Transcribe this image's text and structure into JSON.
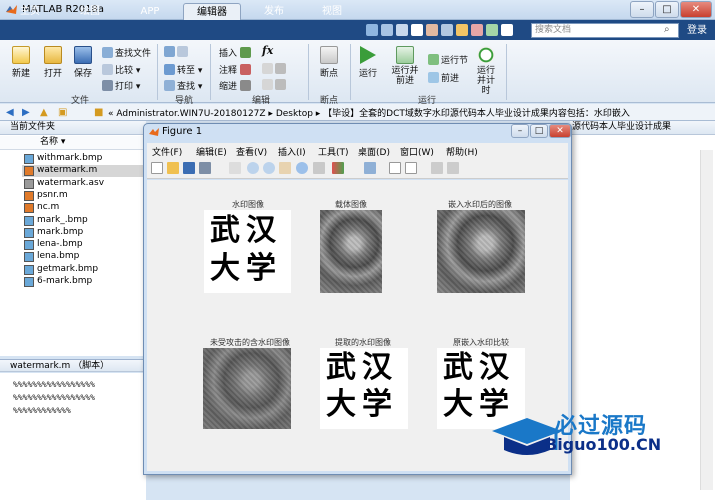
{
  "app": {
    "title": "MATLAB R2018a",
    "window_controls": [
      "–",
      "□",
      "✕"
    ]
  },
  "tabs": [
    {
      "label": "主页"
    },
    {
      "label": "绘图"
    },
    {
      "label": "APP"
    },
    {
      "label": "编辑器",
      "active": true
    },
    {
      "label": "发布"
    },
    {
      "label": "视图"
    }
  ],
  "search": {
    "placeholder": "搜索文档"
  },
  "login_label": "登录",
  "ribbon": {
    "file": {
      "new_label": "新建",
      "open_label": "打开",
      "save_label": "保存",
      "find_files_label": "查找文件",
      "compare_label": "比较",
      "print_label": "打印",
      "group_label": "文件"
    },
    "navigate": {
      "goto_label": "转至",
      "find_label": "查找",
      "group_label": "导航"
    },
    "edit": {
      "insert_label": "插入",
      "comment_label": "注释",
      "indent_label": "缩进",
      "fx_label": "fx",
      "group_label": "编辑"
    },
    "breakpoints": {
      "breakpoints_label": "断点",
      "group_label": "断点"
    },
    "run": {
      "run_label": "运行",
      "run_advance_label": "运行并前进",
      "run_section_label": "运行节",
      "advance_label": "前进",
      "run_time_label": "运行并计时",
      "group_label": "运行"
    }
  },
  "address": {
    "path": "« Administrator.WIN7U-20180127Z ▸ Desktop ▸ 【毕设】全套的DCT域数字水印源代码本人毕业设计成果内容包括：水印嵌入"
  },
  "current_folder": {
    "title": "当前文件夹",
    "column_name": "名称 ▾",
    "files": [
      {
        "name": "withmark.bmp",
        "type": "bmp"
      },
      {
        "name": "watermark.m",
        "type": "m",
        "selected": true
      },
      {
        "name": "watermark.asv",
        "type": "asv"
      },
      {
        "name": "psnr.m",
        "type": "m"
      },
      {
        "name": "nc.m",
        "type": "m"
      },
      {
        "name": "mark_.bmp",
        "type": "bmp"
      },
      {
        "name": "mark.bmp",
        "type": "bmp"
      },
      {
        "name": "lena-.bmp",
        "type": "bmp"
      },
      {
        "name": "lena.bmp",
        "type": "bmp"
      },
      {
        "name": "getmark.bmp",
        "type": "bmp"
      },
      {
        "name": "6-mark.bmp",
        "type": "bmp"
      }
    ]
  },
  "editor_panel": {
    "title": "watermark.m  （脚本）",
    "lines": [
      "%%%%%%%%%%%%%%%%%",
      "%%%%%%%%%%%%%%%%%",
      "%%%%%%%%%%%%"
    ]
  },
  "command_window": {
    "header": "源代码本人毕业设计成果"
  },
  "figure": {
    "title": "Figure 1",
    "menus": [
      "文件(F)",
      "编辑(E)",
      "查看(V)",
      "插入(I)",
      "工具(T)",
      "桌面(D)",
      "窗口(W)",
      "帮助(H)"
    ],
    "subplots": [
      {
        "title": "水印图像",
        "kind": "mark",
        "text_top": "武汉",
        "text_bottom": "大学"
      },
      {
        "title": "载体图像",
        "kind": "photo"
      },
      {
        "title": "嵌入水印后的图像",
        "kind": "photo"
      },
      {
        "title": "未受攻击的含水印图像",
        "kind": "photo-noisy"
      },
      {
        "title": "提取的水印图像",
        "kind": "mark",
        "text_top": "武汉",
        "text_bottom": "大学"
      },
      {
        "title": "原嵌入水印比较",
        "kind": "mark",
        "text_top": "武汉",
        "text_bottom": "大学"
      }
    ]
  },
  "watermark_logo": {
    "line1": "必过源码",
    "line2": "Biguo100.CN"
  },
  "colors": {
    "tabbar": "#1f4a84",
    "ribbon": "#e6edf6",
    "figure_frame": "#cfe0f3",
    "logo_blue": "#1a78c8",
    "logo_dark": "#0b2f88"
  }
}
